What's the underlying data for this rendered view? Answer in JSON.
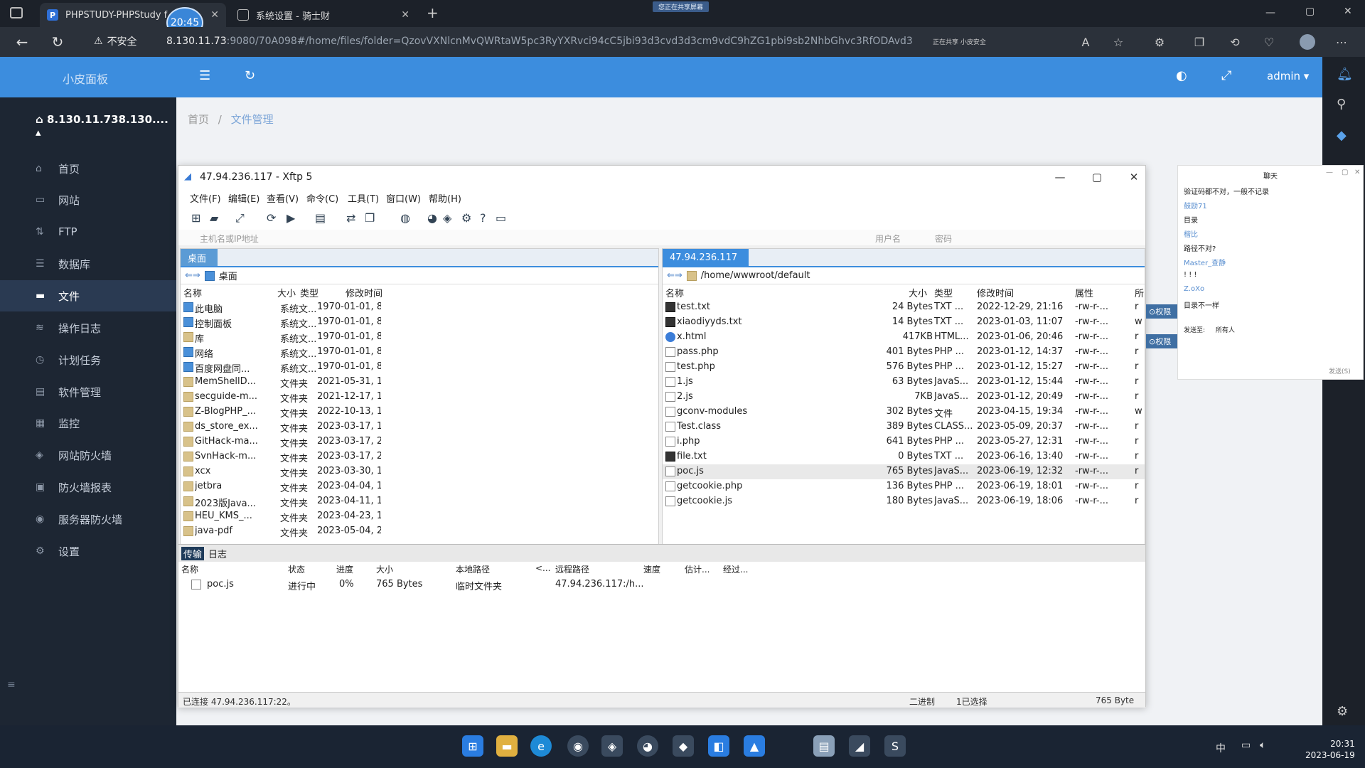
{
  "browser": {
    "tabs": [
      {
        "label": "PHPSTUDY-PHPStudy f",
        "favicon": "P"
      },
      {
        "label": "系统设置 - 骑士财"
      }
    ],
    "time_bubble": "20:45",
    "share_badge": "您正在共享屏幕",
    "insecure_label": "不安全",
    "url_host": "8.130.11.73",
    "url_rest": ":9080/70A098#/home/files/folder=QzovVXNlcnMvQWRtaW5pc3RyYXRvci94cC5jbi93d3cvd3d3cm9vdC9hZG1pbi9sb2NhbGhvc3RfODAvd3c",
    "sync_note": "正在共享 小皮安全"
  },
  "app": {
    "title": "小皮面板",
    "user": "admin",
    "server": "8.130.11.738.130....",
    "nav": [
      {
        "label": "首页",
        "icon": "home-icon"
      },
      {
        "label": "网站",
        "icon": "monitor-icon"
      },
      {
        "label": "FTP",
        "icon": "ftp-icon"
      },
      {
        "label": "数据库",
        "icon": "database-icon"
      },
      {
        "label": "文件",
        "icon": "folder-icon",
        "active": true
      },
      {
        "label": "操作日志",
        "icon": "log-icon"
      },
      {
        "label": "计划任务",
        "icon": "clock-icon"
      },
      {
        "label": "软件管理",
        "icon": "software-icon"
      },
      {
        "label": "监控",
        "icon": "monitor-chart-icon"
      },
      {
        "label": "网站防火墙",
        "icon": "shield-icon"
      },
      {
        "label": "防火墙报表",
        "icon": "report-icon"
      },
      {
        "label": "服务器防火墙",
        "icon": "server-shield-icon"
      },
      {
        "label": "设置",
        "icon": "gear-icon"
      }
    ],
    "breadcrumb": {
      "home": "首页",
      "sep": "/",
      "current": "文件管理"
    }
  },
  "xftp": {
    "title": "47.94.236.117   - Xftp 5",
    "menu": [
      "文件(F)",
      "编辑(E)",
      "查看(V)",
      "命令(C)",
      "工具(T)",
      "窗口(W)",
      "帮助(H)"
    ],
    "address_placeholder": "主机名或IP地址",
    "user_label": "用户名",
    "password_label": "密码",
    "left": {
      "tab": "桌面",
      "path": "桌面",
      "headers": [
        "名称",
        "大小",
        "类型",
        "修改时间"
      ],
      "rows": [
        {
          "name": "此电脑",
          "size": "",
          "type": "系统文...",
          "mtime": "1970-01-01, 8...",
          "kind": "sys"
        },
        {
          "name": "控制面板",
          "size": "",
          "type": "系统文...",
          "mtime": "1970-01-01, 8...",
          "kind": "sys"
        },
        {
          "name": "库",
          "size": "",
          "type": "系统文...",
          "mtime": "1970-01-01, 8...",
          "kind": "folder"
        },
        {
          "name": "网络",
          "size": "",
          "type": "系统文...",
          "mtime": "1970-01-01, 8...",
          "kind": "sys"
        },
        {
          "name": "百度网盘同...",
          "size": "",
          "type": "系统文...",
          "mtime": "1970-01-01, 8...",
          "kind": "sys"
        },
        {
          "name": "MemShellD...",
          "size": "",
          "type": "文件夹",
          "mtime": "2021-05-31, 1...",
          "kind": "folder"
        },
        {
          "name": "secguide-m...",
          "size": "",
          "type": "文件夹",
          "mtime": "2021-12-17, 1...",
          "kind": "folder"
        },
        {
          "name": "Z-BlogPHP_...",
          "size": "",
          "type": "文件夹",
          "mtime": "2022-10-13, 1...",
          "kind": "folder"
        },
        {
          "name": "ds_store_ex...",
          "size": "",
          "type": "文件夹",
          "mtime": "2023-03-17, 1...",
          "kind": "folder"
        },
        {
          "name": "GitHack-ma...",
          "size": "",
          "type": "文件夹",
          "mtime": "2023-03-17, 2...",
          "kind": "folder"
        },
        {
          "name": "SvnHack-m...",
          "size": "",
          "type": "文件夹",
          "mtime": "2023-03-17, 2...",
          "kind": "folder"
        },
        {
          "name": "xcx",
          "size": "",
          "type": "文件夹",
          "mtime": "2023-03-30, 1...",
          "kind": "folder"
        },
        {
          "name": "jetbra",
          "size": "",
          "type": "文件夹",
          "mtime": "2023-04-04, 1...",
          "kind": "folder"
        },
        {
          "name": "2023版Java...",
          "size": "",
          "type": "文件夹",
          "mtime": "2023-04-11, 1...",
          "kind": "folder"
        },
        {
          "name": "HEU_KMS_...",
          "size": "",
          "type": "文件夹",
          "mtime": "2023-04-23, 1...",
          "kind": "folder"
        },
        {
          "name": "java-pdf",
          "size": "",
          "type": "文件夹",
          "mtime": "2023-05-04, 2...",
          "kind": "folder"
        }
      ]
    },
    "right": {
      "tab": "47.94.236.117",
      "path": "/home/wwwroot/default",
      "headers": [
        "名称",
        "大小",
        "类型",
        "修改时间",
        "属性",
        "所"
      ],
      "rows": [
        {
          "name": "test.txt",
          "size": "24 Bytes",
          "type": "TXT ...",
          "mtime": "2022-12-29, 21:16",
          "attr": "-rw-r-...",
          "owner": "r",
          "kind": "dark"
        },
        {
          "name": "xiaodiyyds.txt",
          "size": "14 Bytes",
          "type": "TXT ...",
          "mtime": "2023-01-03, 11:07",
          "attr": "-rw-r-...",
          "owner": "w",
          "kind": "dark"
        },
        {
          "name": "x.html",
          "size": "417KB",
          "type": "HTML...",
          "mtime": "2023-01-06, 20:46",
          "attr": "-rw-r-...",
          "owner": "r",
          "kind": "globe"
        },
        {
          "name": "pass.php",
          "size": "401 Bytes",
          "type": "PHP ...",
          "mtime": "2023-01-12, 14:37",
          "attr": "-rw-r-...",
          "owner": "r",
          "kind": "doc"
        },
        {
          "name": "test.php",
          "size": "576 Bytes",
          "type": "PHP ...",
          "mtime": "2023-01-12, 15:27",
          "attr": "-rw-r-...",
          "owner": "r",
          "kind": "doc"
        },
        {
          "name": "1.js",
          "size": "63 Bytes",
          "type": "JavaS...",
          "mtime": "2023-01-12, 15:44",
          "attr": "-rw-r-...",
          "owner": "r",
          "kind": "doc"
        },
        {
          "name": "2.js",
          "size": "7KB",
          "type": "JavaS...",
          "mtime": "2023-01-12, 20:49",
          "attr": "-rw-r-...",
          "owner": "r",
          "kind": "doc"
        },
        {
          "name": "gconv-modules",
          "size": "302 Bytes",
          "type": "文件",
          "mtime": "2023-04-15, 19:34",
          "attr": "-rw-r-...",
          "owner": "w",
          "kind": "doc"
        },
        {
          "name": "Test.class",
          "size": "389 Bytes",
          "type": "CLASS...",
          "mtime": "2023-05-09, 20:37",
          "attr": "-rw-r-...",
          "owner": "r",
          "kind": "doc"
        },
        {
          "name": "i.php",
          "size": "641 Bytes",
          "type": "PHP ...",
          "mtime": "2023-05-27, 12:31",
          "attr": "-rw-r-...",
          "owner": "r",
          "kind": "doc"
        },
        {
          "name": "file.txt",
          "size": "0 Bytes",
          "type": "TXT ...",
          "mtime": "2023-06-16, 13:40",
          "attr": "-rw-r-...",
          "owner": "r",
          "kind": "dark"
        },
        {
          "name": "poc.js",
          "size": "765 Bytes",
          "type": "JavaS...",
          "mtime": "2023-06-19, 12:32",
          "attr": "-rw-r-...",
          "owner": "r",
          "kind": "doc",
          "selected": true
        },
        {
          "name": "getcookie.php",
          "size": "136 Bytes",
          "type": "PHP ...",
          "mtime": "2023-06-19, 18:01",
          "attr": "-rw-r-...",
          "owner": "r",
          "kind": "doc"
        },
        {
          "name": "getcookie.js",
          "size": "180 Bytes",
          "type": "JavaS...",
          "mtime": "2023-06-19, 18:06",
          "attr": "-rw-r-...",
          "owner": "r",
          "kind": "doc"
        }
      ]
    },
    "transfer": {
      "tabs": [
        "传输",
        "日志"
      ],
      "headers": [
        "名称",
        "状态",
        "进度",
        "大小",
        "本地路径",
        "<...",
        "远程路径",
        "速度",
        "估计...",
        "经过..."
      ],
      "row": {
        "name": "poc.js",
        "status": "进行中",
        "progress": "0%",
        "size": "765 Bytes",
        "local": "临时文件夹",
        "remote": "47.94.236.117:/h..."
      }
    },
    "status": {
      "connected": "已连接 47.94.236.117:22。",
      "mode": "二进制",
      "selected": "1已选择",
      "size": "765 Byte"
    }
  },
  "chat": {
    "title": "聊天",
    "messages": [
      "验证码都不对，一般不记录",
      "鼓励71",
      "目录",
      "楷比",
      "路径不对?",
      "Master_查静",
      "! ! !",
      "Z.oXo",
      "目录不一样"
    ],
    "send_to_label": "发送至:",
    "send_to_value": "所有人",
    "send_button": "发送(S)",
    "badge_label": "权限"
  },
  "taskbar": {
    "time": "20:31",
    "date": "2023-06-19",
    "ime": "中"
  }
}
